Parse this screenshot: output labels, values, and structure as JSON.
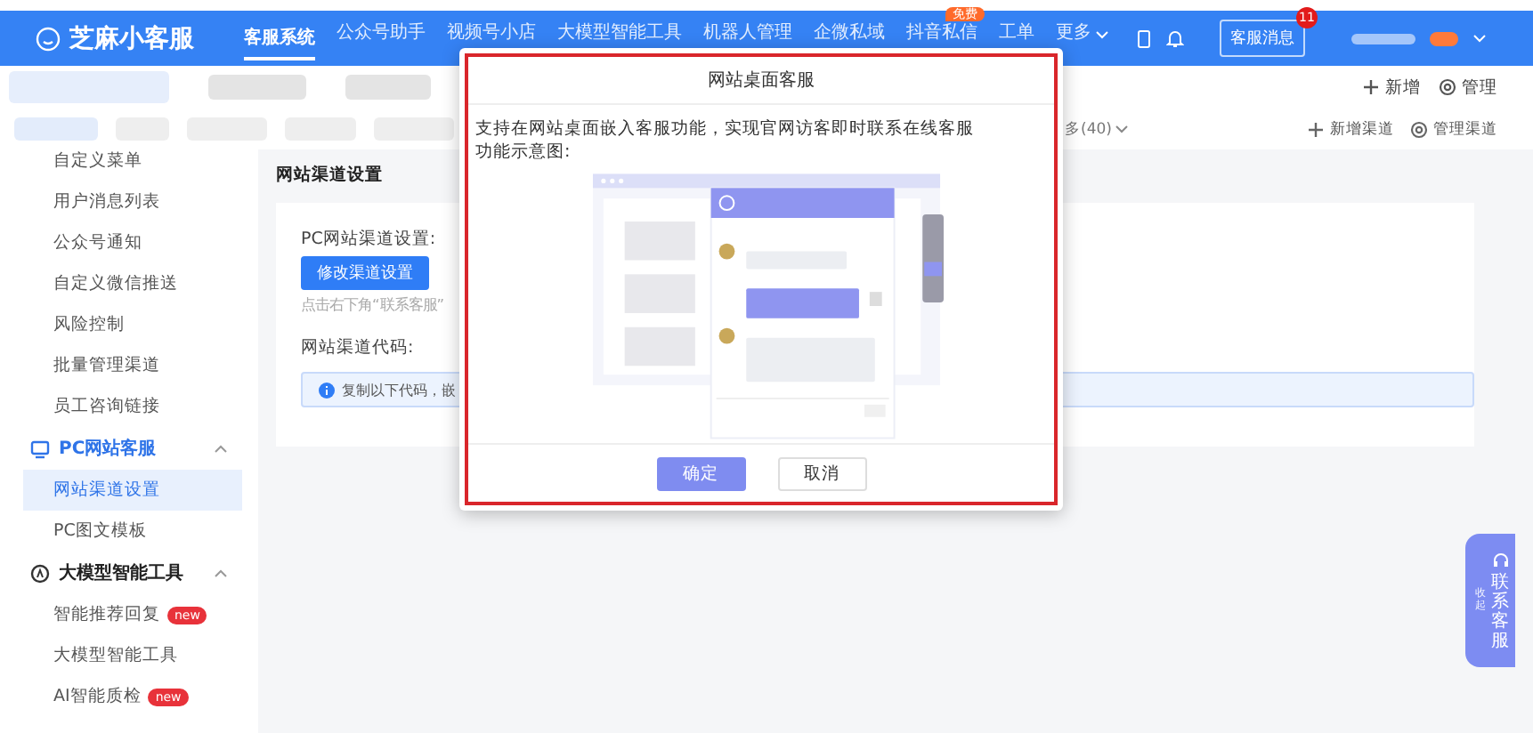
{
  "header": {
    "logo": "芝麻小客服",
    "nav": [
      {
        "label": "客服系统",
        "selected": true
      },
      {
        "label": "公众号助手",
        "selected": false
      },
      {
        "label": "视频号小店",
        "selected": false
      },
      {
        "label": "大模型智能工具",
        "selected": false
      },
      {
        "label": "机器人管理",
        "selected": false
      },
      {
        "label": "企微私域",
        "selected": false
      },
      {
        "label": "抖音私信",
        "selected": false,
        "badge": "免费"
      },
      {
        "label": "工单",
        "selected": false
      },
      {
        "label": "更多",
        "selected": false,
        "dropdown": true
      }
    ],
    "message_button": "客服消息",
    "message_count": "11"
  },
  "tab_bar": {
    "tabs": [
      {
        "selected": true
      },
      {
        "selected": false
      },
      {
        "selected": false
      }
    ],
    "actions": [
      {
        "label": "新增"
      },
      {
        "label": "管理"
      }
    ]
  },
  "filter_bar": {
    "filters": [
      {
        "selected": true
      },
      {
        "selected": false
      },
      {
        "selected": false
      },
      {
        "selected": false
      },
      {
        "selected": false
      }
    ],
    "overflow": "多(40)",
    "actions": [
      {
        "label": "新增渠道"
      },
      {
        "label": "管理渠道"
      }
    ]
  },
  "sidebar": {
    "items": [
      {
        "kind": "item",
        "label": "自定义菜单",
        "selected": false
      },
      {
        "kind": "item",
        "label": "用户消息列表",
        "selected": false
      },
      {
        "kind": "item",
        "label": "公众号通知",
        "selected": false
      },
      {
        "kind": "item",
        "label": "自定义微信推送",
        "selected": false
      },
      {
        "kind": "item",
        "label": "风险控制",
        "selected": false
      },
      {
        "kind": "item",
        "label": "批量管理渠道",
        "selected": false
      },
      {
        "kind": "item",
        "label": "员工咨询链接",
        "selected": false
      },
      {
        "kind": "section",
        "label": "PC网站客服",
        "active": true,
        "expanded": true
      },
      {
        "kind": "item",
        "label": "网站渠道设置",
        "selected": true
      },
      {
        "kind": "item",
        "label": "PC图文模板",
        "selected": false
      },
      {
        "kind": "section",
        "label": "大模型智能工具",
        "active": false,
        "expanded": true
      },
      {
        "kind": "item",
        "label": "智能推荐回复",
        "selected": false,
        "badge": "new"
      },
      {
        "kind": "item",
        "label": "大模型智能工具",
        "selected": false
      },
      {
        "kind": "item",
        "label": "AI智能质检",
        "selected": false,
        "badge": "new"
      }
    ]
  },
  "content": {
    "title": "网站渠道设置",
    "pc_label": "PC网站渠道设置:",
    "edit_button": "修改渠道设置",
    "hint": "点击右下角“联系客服”",
    "code_label": "网站渠道代码:",
    "info": "复制以下代码，嵌"
  },
  "modal": {
    "title": "网站桌面客服",
    "description": "支持在网站桌面嵌入客服功能，实现官网访客即时联系在线客服",
    "caption": "功能示意图:",
    "buttons": [
      {
        "label": "确定",
        "kind": "primary"
      },
      {
        "label": "取消",
        "kind": "secondary"
      }
    ]
  },
  "float_contact": {
    "label": "联系客服",
    "collapse": "收起"
  }
}
